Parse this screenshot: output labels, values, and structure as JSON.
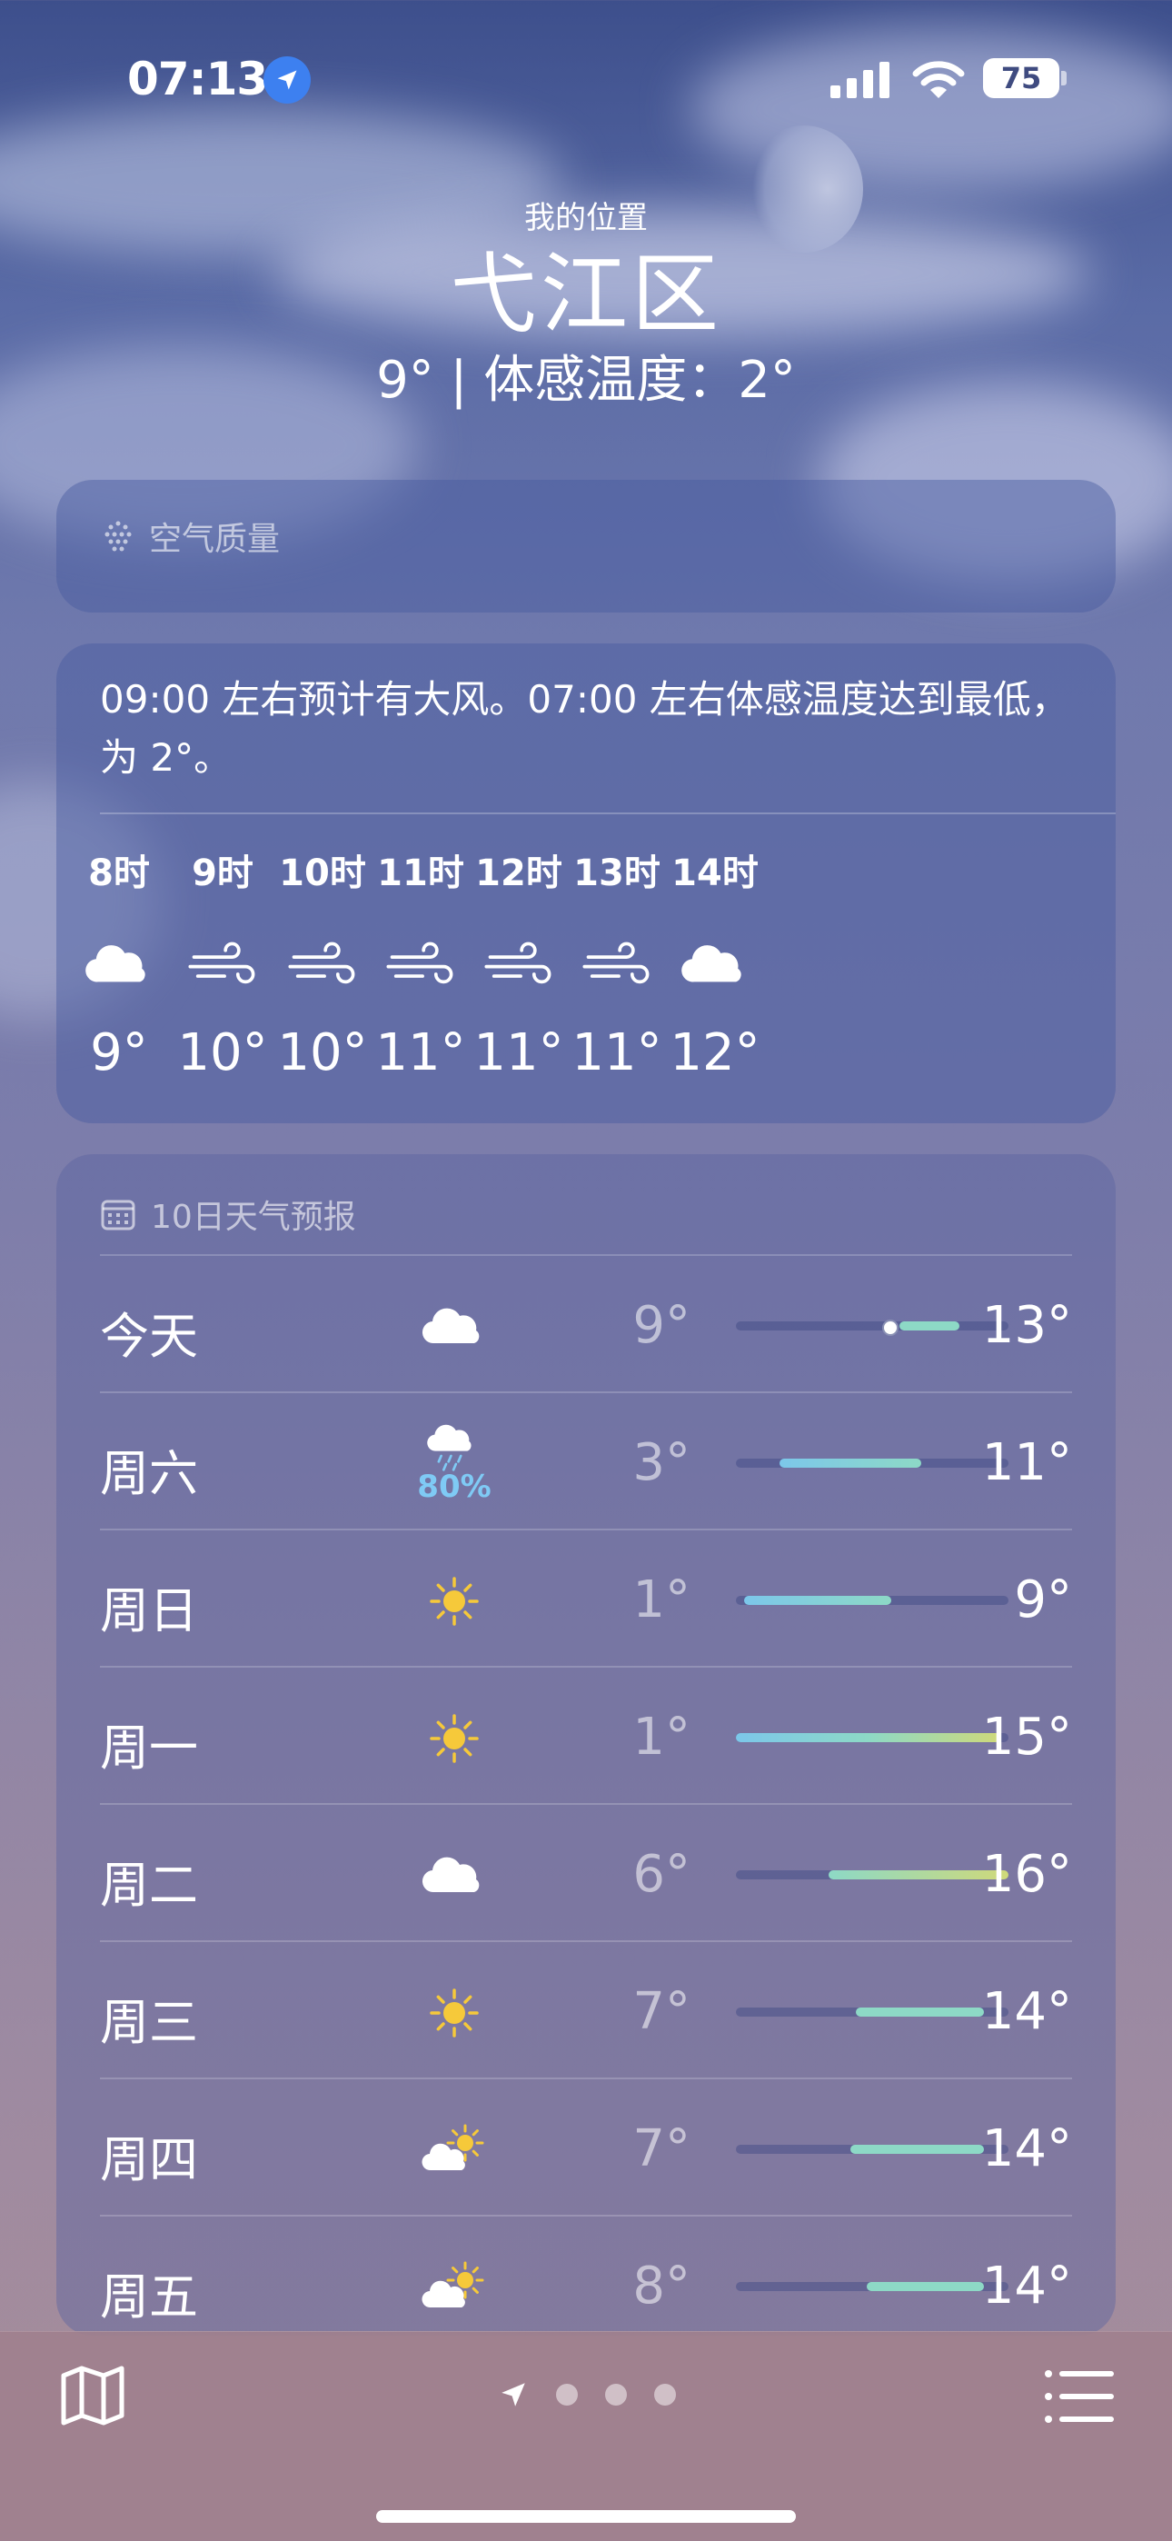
{
  "status_bar": {
    "time": "07:13",
    "battery": "75"
  },
  "header": {
    "my_location": "我的位置",
    "city": "弋江区",
    "temp_line": "9° | 体感温度：2°"
  },
  "air_quality": {
    "title": "空气质量",
    "icon": "air-quality-icon"
  },
  "hourly": {
    "note": "09:00 左右预计有大风。07:00 左右体感温度达到最低，为 2°。",
    "hours": [
      {
        "label": "8时",
        "icon": "cloud-icon",
        "temp": "9°"
      },
      {
        "label": "9时",
        "icon": "wind-icon",
        "temp": "10°"
      },
      {
        "label": "10时",
        "icon": "wind-icon",
        "temp": "10°"
      },
      {
        "label": "11时",
        "icon": "wind-icon",
        "temp": "11°"
      },
      {
        "label": "12时",
        "icon": "wind-icon",
        "temp": "11°"
      },
      {
        "label": "13时",
        "icon": "wind-icon",
        "temp": "11°"
      },
      {
        "label": "14时",
        "icon": "cloud-icon",
        "temp": "12°"
      }
    ]
  },
  "daily": {
    "title": "10日天气预报",
    "icon": "calendar-icon",
    "days": [
      {
        "name": "今天",
        "icon": "cloud-icon",
        "precip": "",
        "lo": "9°",
        "hi": "13°",
        "start": 0.6,
        "end": 0.82,
        "current": 0.56
      },
      {
        "name": "周六",
        "icon": "rain-cloud-icon",
        "precip": "80%",
        "lo": "3°",
        "hi": "11°",
        "start": 0.16,
        "end": 0.68
      },
      {
        "name": "周日",
        "icon": "sun-icon",
        "precip": "",
        "lo": "1°",
        "hi": "9°",
        "start": 0.03,
        "end": 0.57
      },
      {
        "name": "周一",
        "icon": "sun-icon",
        "precip": "",
        "lo": "1°",
        "hi": "15°",
        "start": 0.0,
        "end": 0.97
      },
      {
        "name": "周二",
        "icon": "cloud-icon",
        "precip": "",
        "lo": "6°",
        "hi": "16°",
        "start": 0.34,
        "end": 1.0
      },
      {
        "name": "周三",
        "icon": "sun-icon",
        "precip": "",
        "lo": "7°",
        "hi": "14°",
        "start": 0.44,
        "end": 0.91
      },
      {
        "name": "周四",
        "icon": "partly-cloudy-icon",
        "precip": "",
        "lo": "7°",
        "hi": "14°",
        "start": 0.42,
        "end": 0.91
      },
      {
        "name": "周五",
        "icon": "partly-cloudy-icon",
        "precip": "",
        "lo": "8°",
        "hi": "14°",
        "start": 0.48,
        "end": 0.91
      }
    ]
  },
  "colors": {
    "bar_blue": "#7cc7ea",
    "bar_teal": "#8dd9c6",
    "bar_yellow": "#cfd97a",
    "sun": "#f6c93a",
    "rain": "#7fcaf5"
  }
}
